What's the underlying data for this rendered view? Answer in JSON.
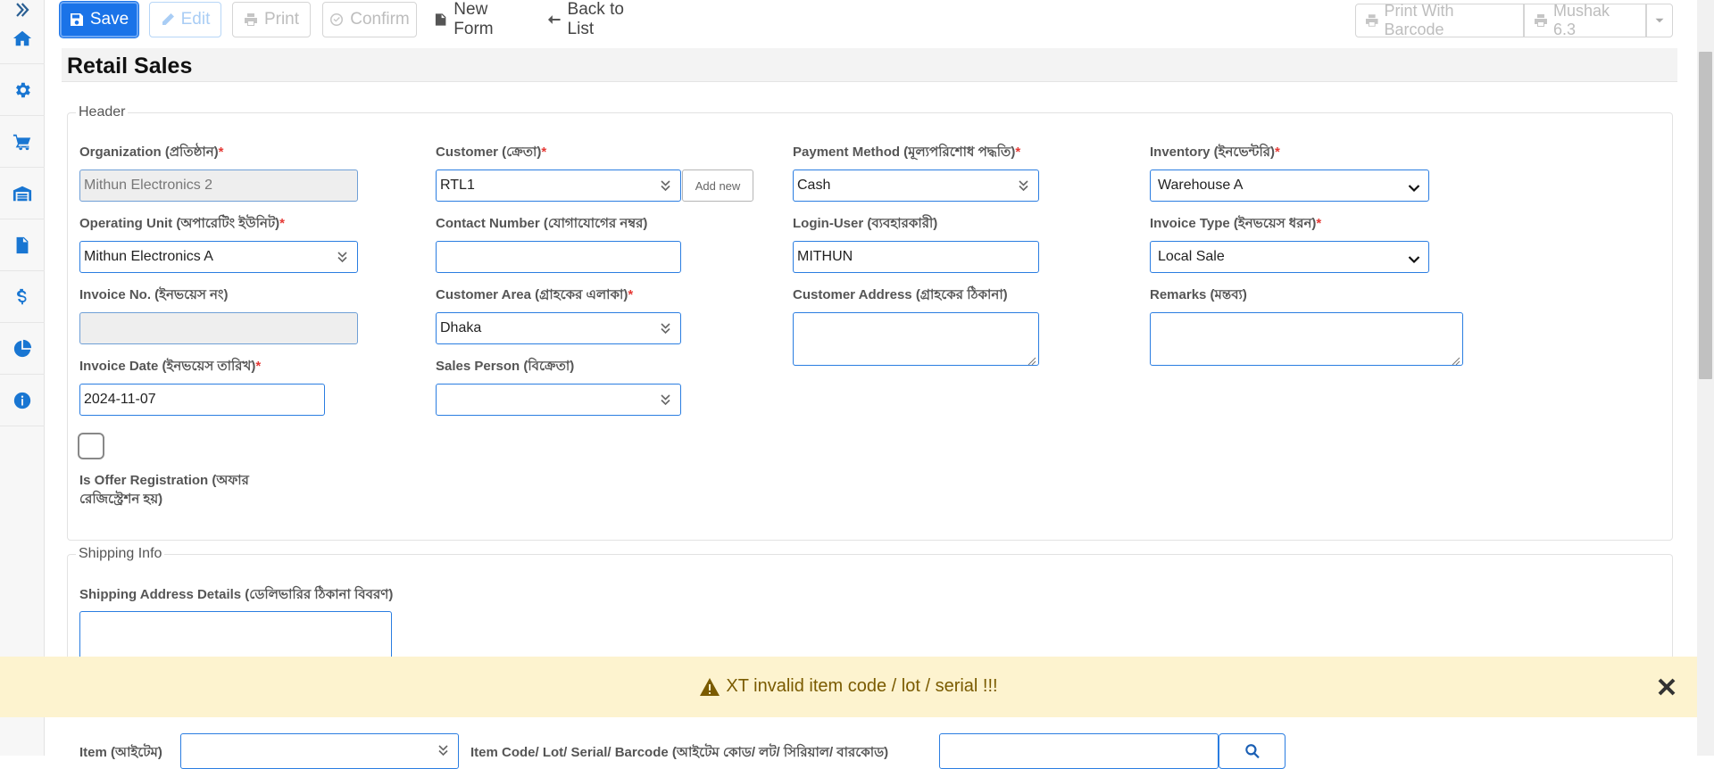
{
  "toolbar": {
    "save": "Save",
    "edit": "Edit",
    "print": "Print",
    "confirm": "Confirm",
    "new_form": "New Form",
    "back_to_list": "Back to List",
    "print_with_barcode": "Print With Barcode",
    "mushak": "Mushak 6.3"
  },
  "page": {
    "title": "Retail Sales"
  },
  "header": {
    "legend": "Header",
    "organization": {
      "label": "Organization (প্রতিষ্ঠান)",
      "value": "Mithun Electronics 2"
    },
    "customer": {
      "label": "Customer (ক্রেতা)",
      "value": "RTL1",
      "add_new": "Add new"
    },
    "payment_method": {
      "label": "Payment Method (মূল্যপরিশোধ পদ্ধতি)",
      "value": "Cash"
    },
    "inventory": {
      "label": "Inventory (ইনভেন্টরি)",
      "value": "Warehouse A"
    },
    "operating_unit": {
      "label": "Operating Unit (অপারেটিং ইউনিট)",
      "value": "Mithun Electronics A"
    },
    "contact_number": {
      "label": "Contact Number (যোগাযোগের নম্বর)",
      "value": ""
    },
    "login_user": {
      "label": "Login-User (ব্যবহারকারী)",
      "value": "MITHUN"
    },
    "invoice_type": {
      "label": "Invoice Type (ইনভয়েস ধরন)",
      "value": "Local Sale"
    },
    "invoice_no": {
      "label": "Invoice No. (ইনভয়েস নং)",
      "value": ""
    },
    "customer_area": {
      "label": "Customer Area (গ্রাহকের এলাকা)",
      "value": "Dhaka"
    },
    "customer_address": {
      "label": "Customer Address (গ্রাহকের ঠিকানা)",
      "value": ""
    },
    "remarks": {
      "label": "Remarks (মন্তব্য)",
      "value": ""
    },
    "invoice_date": {
      "label": "Invoice Date (ইনভয়েস তারিখ)",
      "value": "2024-11-07"
    },
    "sales_person": {
      "label": "Sales Person (বিক্রেতা)",
      "value": ""
    },
    "offer_registration": {
      "label_line1": "Is Offer Registration (অফার",
      "label_line2": "রেজিস্ট্রেশন হয়)",
      "checked": false
    },
    "required_mark": "*"
  },
  "shipping": {
    "legend": "Shipping Info",
    "address_label": "Shipping Address Details (ডেলিভারির ঠিকানা বিবরণ)",
    "address_value": ""
  },
  "items": {
    "item_label": "Item (আইটেম)",
    "code_label": "Item Code/ Lot/ Serial/ Barcode (আইটেম কোড/ লট/ সিরিয়াল/ বারকোড)"
  },
  "alert": {
    "message": "XT invalid item code / lot / serial !!!"
  },
  "colors": {
    "primary": "#1a73e8",
    "alert_bg": "#fdf3cf",
    "alert_text": "#7a5b00",
    "required": "#e53935"
  },
  "icons": [
    "double-chevron-right-icon",
    "home-icon",
    "gear-icon",
    "cart-icon",
    "warehouse-icon",
    "invoice-icon",
    "dollar-icon",
    "pie-chart-icon",
    "info-icon"
  ]
}
